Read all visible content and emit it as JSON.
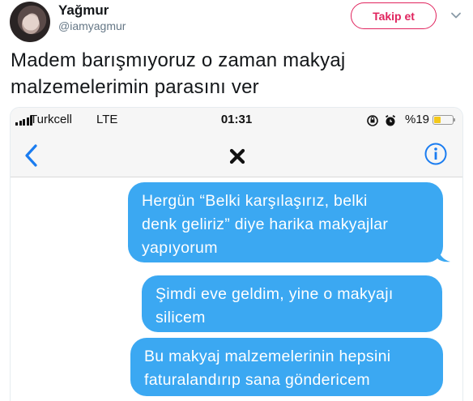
{
  "user": {
    "display_name": "Yağmur",
    "handle": "@iamyagmur"
  },
  "follow_button": {
    "label": "Takip et"
  },
  "tweet": {
    "text_line_1": "Madem barışmıyoruz o zaman makyaj",
    "text_line_2": "malzemelerimin parasını ver"
  },
  "screenshot": {
    "status_bar": {
      "carrier": "Turkcell",
      "network": "LTE",
      "time": "01:31",
      "battery_percent": "%19"
    },
    "icons": [
      "back-chevron",
      "close-x",
      "info-circle",
      "screen-lock-rotation",
      "alarm-clock",
      "battery-low"
    ],
    "messages": [
      {
        "lines": [
          "Hergün “Belki karşılaşırız, belki",
          "denk geliriz” diye harika makyajlar",
          "yapıyorum"
        ]
      },
      {
        "lines": [
          "Şimdi eve geldim, yine o makyajı",
          "silicem"
        ]
      },
      {
        "lines": [
          "Bu makyaj malzemelerinin hepsini",
          "faturalandırıp sana göndericem"
        ]
      }
    ],
    "colors": {
      "bubble": "#3ba8f2",
      "ios_blue": "#1a7cf0",
      "battery": "#f3c81b"
    }
  },
  "colors": {
    "follow_accent": "#e0245e",
    "handle_gray": "#657786"
  }
}
